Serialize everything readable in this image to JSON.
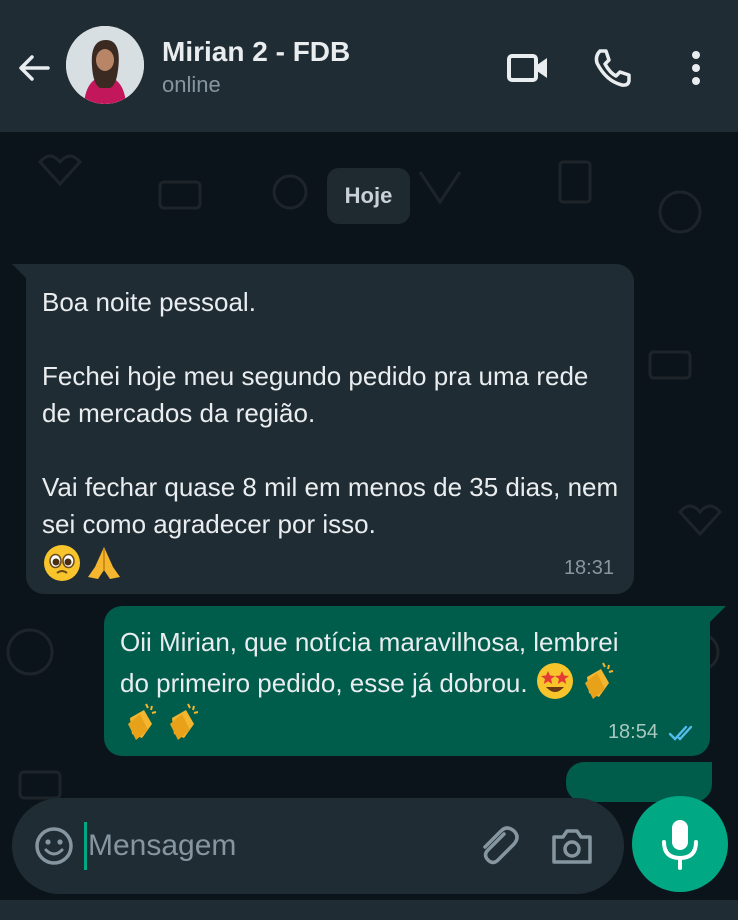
{
  "header": {
    "contact_name": "Mirian 2 - FDB",
    "status": "online",
    "icons": [
      "back-arrow-icon",
      "video-call-icon",
      "voice-call-icon",
      "more-options-icon"
    ]
  },
  "chat": {
    "date_label": "Hoje",
    "messages": [
      {
        "direction": "incoming",
        "text": "Boa noite pessoal.\n\nFechei hoje meu segundo pedido pra uma rede de mercados da região.\n\nVai fechar quase 8 mil em menos de 35 dias, nem sei como agradecer por isso.",
        "emojis": [
          "pleading-face-emoji",
          "folded-hands-emoji"
        ],
        "time": "18:31"
      },
      {
        "direction": "outgoing",
        "text": "Oii Mirian, que notícia maravilhosa, lembrei do primeiro pedido, esse já dobrou.",
        "emojis": [
          "star-struck-emoji",
          "clapping-hands-emoji",
          "clapping-hands-emoji",
          "clapping-hands-emoji"
        ],
        "time": "18:54",
        "status": "read"
      }
    ]
  },
  "composer": {
    "placeholder": "Mensagem"
  },
  "colors": {
    "header_bg": "#1f2c33",
    "chat_bg": "#0b141a",
    "incoming_bubble": "#202c33",
    "outgoing_bubble": "#005c4b",
    "accent": "#00a884",
    "read_ticks": "#53bdeb"
  }
}
